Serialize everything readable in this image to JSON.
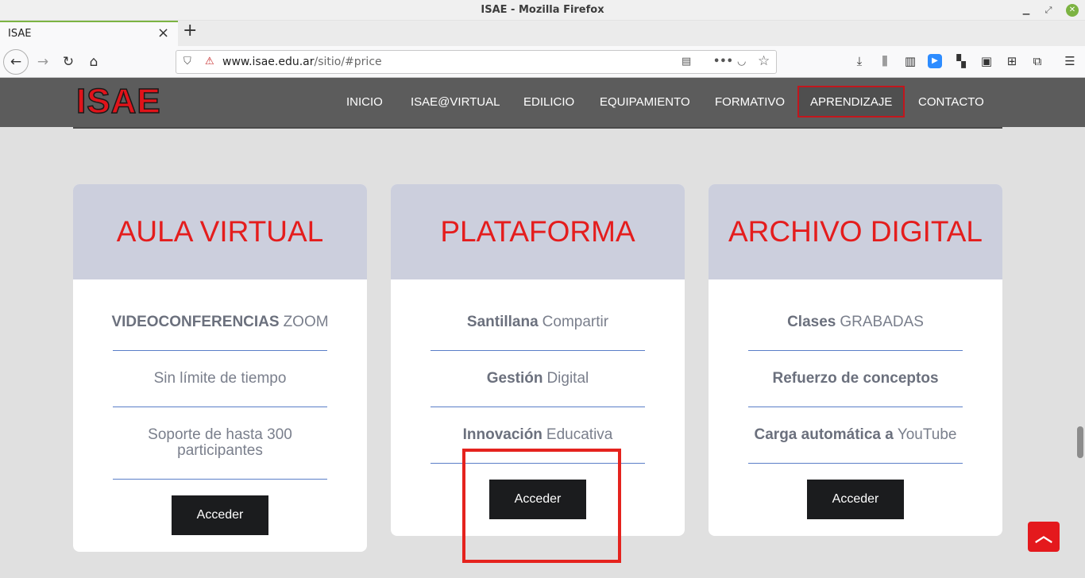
{
  "window": {
    "title": "ISAE - Mozilla Firefox"
  },
  "tab": {
    "title": "ISAE"
  },
  "urlbar": {
    "url_domain": "www.isae.edu.ar",
    "url_path": "/sitio/#price"
  },
  "site": {
    "logo": "ISAE",
    "nav": [
      "INICIO",
      "ISAE@VIRTUAL",
      "EDILICIO",
      "EQUIPAMIENTO",
      "FORMATIVO",
      "APRENDIZAJE",
      "CONTACTO"
    ],
    "active_nav": "APRENDIZAJE"
  },
  "cards": [
    {
      "title": "AULA VIRTUAL",
      "features": [
        {
          "bold": "VIDEOCONFERENCIAS",
          "text": "ZOOM"
        },
        {
          "bold": "",
          "text": "Sin límite de tiempo"
        },
        {
          "bold": "",
          "text": "Soporte de hasta 300 participantes"
        }
      ],
      "button": "Acceder"
    },
    {
      "title": "PLATAFORMA",
      "features": [
        {
          "bold": "Santillana",
          "text": "Compartir"
        },
        {
          "bold": "Gestión",
          "text": "Digital"
        },
        {
          "bold": "Innovación",
          "text": "Educativa"
        }
      ],
      "button": "Acceder"
    },
    {
      "title": "ARCHIVO DIGITAL",
      "features": [
        {
          "bold": "Clases",
          "text": "GRABADAS"
        },
        {
          "bold": "Refuerzo de conceptos",
          "text": ""
        },
        {
          "bold": "Carga automática a",
          "text": "YouTube"
        }
      ],
      "button": "Acceder"
    }
  ],
  "colors": {
    "accent_red": "#e41d1d",
    "header_bg": "#5c5c5c",
    "card_head_bg": "#cccfdd",
    "button_bg": "#1b1c1e"
  },
  "icons": {
    "scroll_top": "chevron-up-icon"
  }
}
